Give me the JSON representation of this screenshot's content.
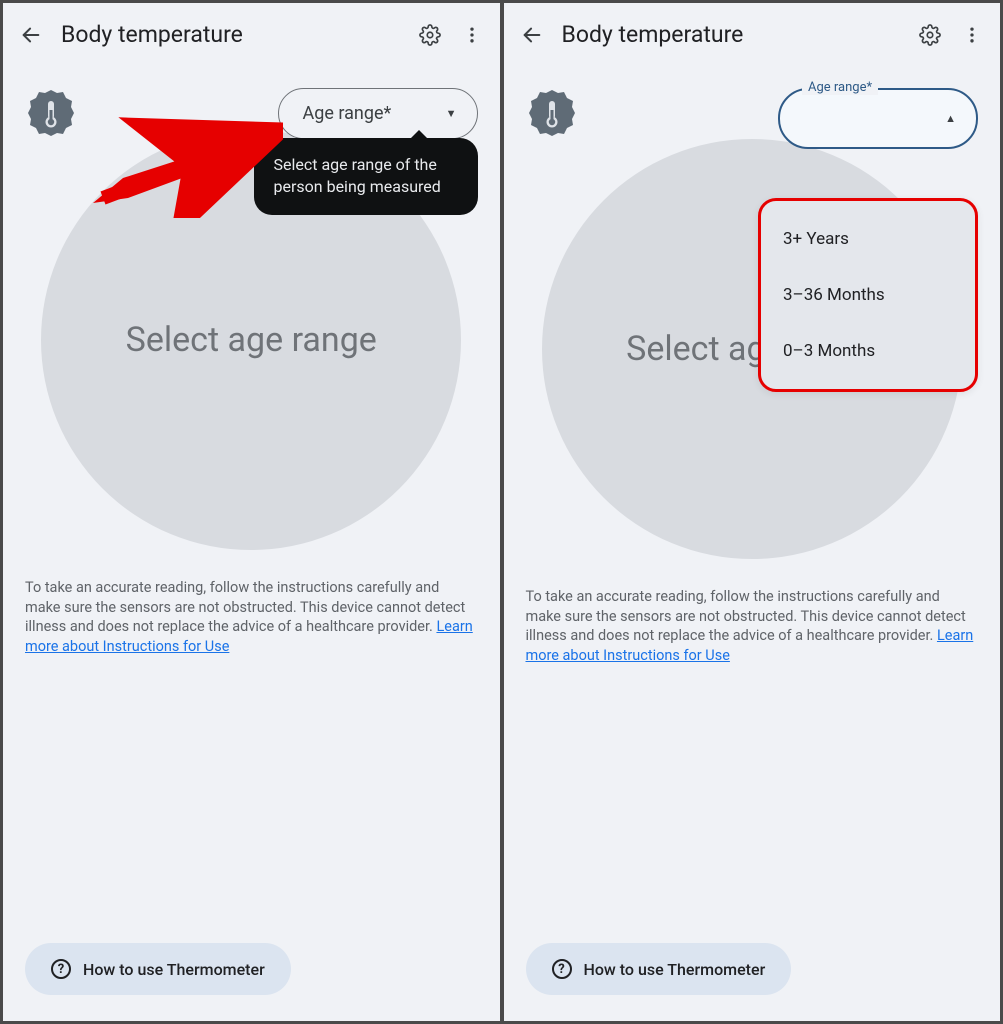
{
  "header": {
    "title": "Body temperature"
  },
  "ageSelect": {
    "label": "Age range*",
    "floatingLabel": "Age range*",
    "tooltip": "Select age range of the person being measured",
    "options": [
      "3+ Years",
      "3–36 Months",
      "0–3 Months"
    ]
  },
  "main": {
    "placeholder": "Select age range"
  },
  "disclaimer": {
    "text": "To take an accurate reading, follow the instructions carefully and make sure the sensors are not obstructed. This device cannot detect illness and does not replace the advice of a healthcare provider. ",
    "linkText": "Learn more about Instructions for Use"
  },
  "howto": {
    "label": "How to use Thermometer"
  }
}
